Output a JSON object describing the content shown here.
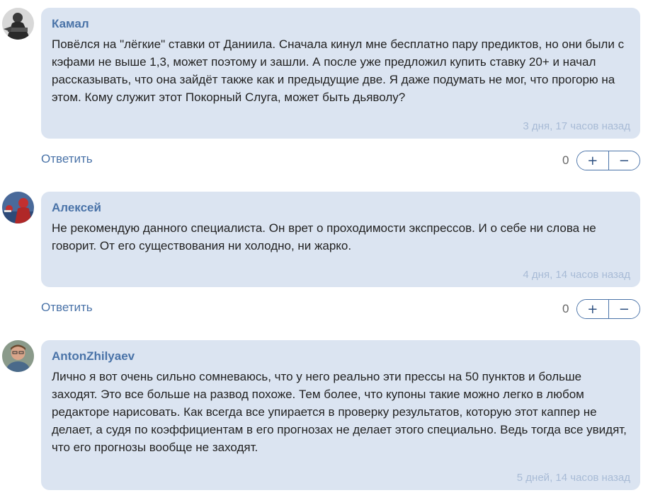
{
  "comments": [
    {
      "author": "Камал",
      "text": "Повёлся на \"лёгкие\" ставки от Даниила. Сначала кинул мне бесплатно пару предиктов, но они были с кэфами не выше 1,3, может поэтому и зашли. А после уже предложил купить ставку 20+ и начал рассказывать, что она зайдёт также как и предыдущие две. Я даже подумать не мог, что прогорю на этом. Кому служит этот Покорный Слуга, может быть дьяволу?",
      "time": "3 дня, 17 часов назад",
      "reply_label": "Ответить",
      "score": "0",
      "plus": "+",
      "minus": "−"
    },
    {
      "author": "Алексей",
      "text": "Не рекомендую данного специалиста. Он врет о проходимости экспрессов. И о себе ни слова не говорит. От его существования ни холодно, ни жарко.",
      "time": "4 дня, 14 часов назад",
      "reply_label": "Ответить",
      "score": "0",
      "plus": "+",
      "minus": "−"
    },
    {
      "author": "AntonZhilyaev",
      "text": "Лично я вот очень сильно сомневаюсь, что у него реально эти прессы на 50 пунктов и больше заходят. Это все больше на развод похоже. Тем более, что купоны такие можно легко в любом редакторе нарисовать. Как всегда все упирается в проверку результатов, которую этот каппер не делает, а судя по коэффициентам в его прогнозах не делает этого специально. Ведь тогда все увидят, что его прогнозы вообще не заходят.",
      "time": "5 дней, 14 часов назад"
    }
  ],
  "colors": {
    "bubble": "#dbe4f1",
    "author": "#4a73a8",
    "link": "#4a73a8",
    "timestamp": "#a8bbd6"
  }
}
